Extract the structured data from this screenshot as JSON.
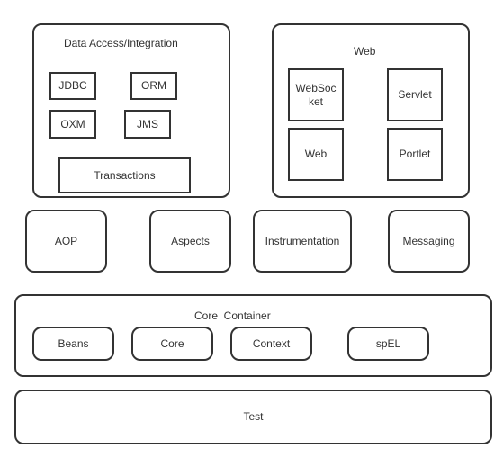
{
  "data_access": {
    "title": "Data Access/Integration",
    "items": [
      "JDBC",
      "ORM",
      "OXM",
      "JMS",
      "Transactions"
    ]
  },
  "web": {
    "title": "Web",
    "items": [
      "WebSoc\nket",
      "Servlet",
      "Web",
      "Portlet"
    ]
  },
  "middle": [
    "AOP",
    "Aspects",
    "Instrumentation",
    "Messaging"
  ],
  "core": {
    "title": "Core  Container",
    "items": [
      "Beans",
      "Core",
      "Context",
      "spEL"
    ]
  },
  "test": "Test"
}
